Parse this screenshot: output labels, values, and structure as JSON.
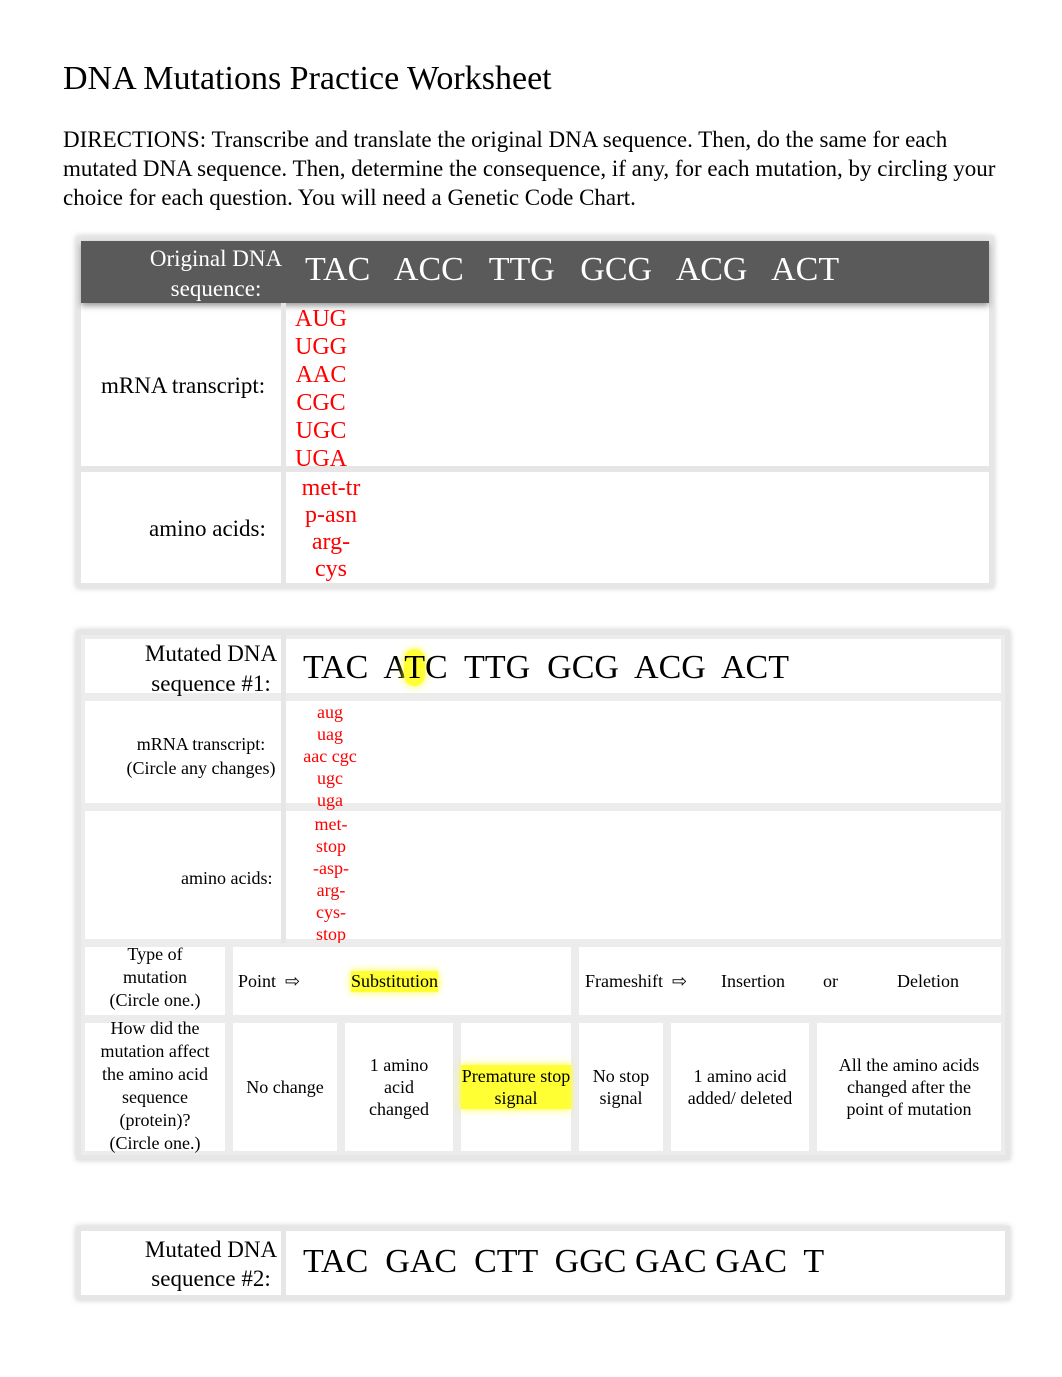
{
  "title": "DNA Mutations Practice Worksheet",
  "directions": "DIRECTIONS: Transcribe and translate the original DNA sequence. Then, do the same for each mutated DNA sequence. Then, determine the consequence, if any, for each mutation, by circling your choice for each question. You will need a Genetic Code Chart.",
  "original": {
    "dna_label_1": "Original DNA",
    "dna_label_2": "sequence:",
    "dna": "TAC   ACC   TTG   GCG   ACG   ACT",
    "mrna_label": "mRNA transcript:",
    "mrna": [
      "AUG",
      "UGG",
      "AAC",
      "CGC",
      "UGC",
      "UGA"
    ],
    "aa_label": "amino acids:",
    "aa": [
      "met-tr",
      "p-asn",
      "arg-",
      "cys"
    ]
  },
  "mutated1": {
    "dna_label_1": "Mutated DNA",
    "dna_label_2": "sequence #1:",
    "dna_pre": "TAC  ",
    "dna_hl_a": "A",
    "dna_hl": "T",
    "dna_hl_b": "C",
    "dna_post": "  TTG  GCG  ACG  ACT",
    "mrna_label_1": "mRNA transcript:",
    "mrna_label_2": "(Circle any changes)",
    "mrna": [
      "aug",
      "uag",
      "aac cgc",
      "ugc",
      "uga"
    ],
    "aa_label": "amino acids:",
    "aa": [
      "met-",
      "stop",
      "-asp-",
      "arg-",
      "cys-",
      "stop"
    ],
    "type_label": [
      "Type of",
      "mutation",
      "(Circle one.)"
    ],
    "point": "Point",
    "arrow": "⇨",
    "substitution": "Substitution",
    "frameshift": "Frameshift",
    "insertion": "Insertion",
    "or": "or",
    "deletion": "Deletion",
    "effect_label": [
      "How did the",
      "mutation affect",
      "the amino acid",
      "sequence",
      "(protein)?",
      "(Circle one.)"
    ],
    "effects": [
      "No change",
      "1 amino acid changed",
      "Premature stop signal",
      "No stop signal",
      "1 amino acid added/ deleted",
      "All the amino acids changed after the point of mutation"
    ],
    "highlight_color": "#ffff33"
  },
  "mutated2": {
    "dna_label_1": "Mutated DNA",
    "dna_label_2": "sequence #2:",
    "dna": "TAC  GAC  CTT  GGC GAC GAC  T"
  },
  "colors": {
    "header_bg": "#5a5a5a",
    "answer": "#ff0000"
  }
}
